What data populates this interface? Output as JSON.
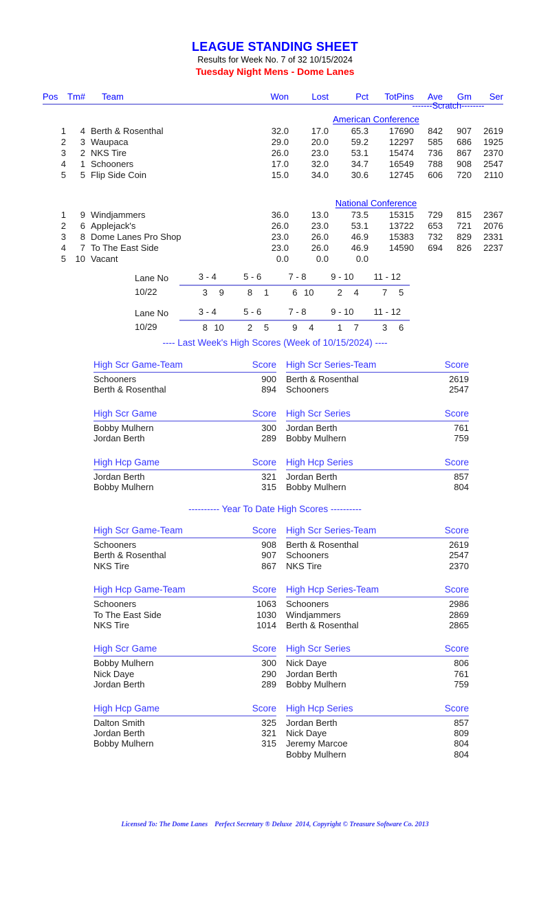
{
  "header": {
    "title": "LEAGUE STANDING SHEET",
    "results_line": "Results for Week No. 7 of 32    10/15/2024",
    "league_line": "Tuesday Night Mens - Dome Lanes",
    "title_color": "#0000ff",
    "league_color": "#ff0000"
  },
  "standings": {
    "scratch_label": "-------Scratch--------",
    "columns": {
      "pos": "Pos",
      "tm": "Tm#",
      "team": "Team",
      "won": "Won",
      "lost": "Lost",
      "pct": "Pct",
      "totpins": "TotPins",
      "ave": "Ave",
      "gm": "Gm",
      "ser": "Ser"
    },
    "conferences": [
      {
        "name": "American Conference",
        "rows": [
          {
            "pos": "1",
            "tm": "4",
            "team": "Berth & Rosenthal",
            "won": "32.0",
            "lost": "17.0",
            "pct": "65.3",
            "totpins": "17690",
            "ave": "842",
            "gm": "907",
            "ser": "2619"
          },
          {
            "pos": "2",
            "tm": "3",
            "team": "Waupaca",
            "won": "29.0",
            "lost": "20.0",
            "pct": "59.2",
            "totpins": "12297",
            "ave": "585",
            "gm": "686",
            "ser": "1925"
          },
          {
            "pos": "3",
            "tm": "2",
            "team": "NKS Tire",
            "won": "26.0",
            "lost": "23.0",
            "pct": "53.1",
            "totpins": "15474",
            "ave": "736",
            "gm": "867",
            "ser": "2370"
          },
          {
            "pos": "4",
            "tm": "1",
            "team": "Schooners",
            "won": "17.0",
            "lost": "32.0",
            "pct": "34.7",
            "totpins": "16549",
            "ave": "788",
            "gm": "908",
            "ser": "2547"
          },
          {
            "pos": "5",
            "tm": "5",
            "team": "Flip Side Coin",
            "won": "15.0",
            "lost": "34.0",
            "pct": "30.6",
            "totpins": "12745",
            "ave": "606",
            "gm": "720",
            "ser": "2110"
          }
        ]
      },
      {
        "name": "National Conference",
        "rows": [
          {
            "pos": "1",
            "tm": "9",
            "team": "Windjammers",
            "won": "36.0",
            "lost": "13.0",
            "pct": "73.5",
            "totpins": "15315",
            "ave": "729",
            "gm": "815",
            "ser": "2367"
          },
          {
            "pos": "2",
            "tm": "6",
            "team": "Applejack's",
            "won": "26.0",
            "lost": "23.0",
            "pct": "53.1",
            "totpins": "13722",
            "ave": "653",
            "gm": "721",
            "ser": "2076"
          },
          {
            "pos": "3",
            "tm": "8",
            "team": "Dome Lanes Pro Shop",
            "won": "23.0",
            "lost": "26.0",
            "pct": "46.9",
            "totpins": "15383",
            "ave": "732",
            "gm": "829",
            "ser": "2331"
          },
          {
            "pos": "4",
            "tm": "7",
            "team": "To The East Side",
            "won": "23.0",
            "lost": "26.0",
            "pct": "46.9",
            "totpins": "14590",
            "ave": "694",
            "gm": "826",
            "ser": "2237"
          },
          {
            "pos": "5",
            "tm": "10",
            "team": "Vacant",
            "won": "0.0",
            "lost": "0.0",
            "pct": "0.0",
            "totpins": "",
            "ave": "",
            "gm": "",
            "ser": ""
          }
        ]
      }
    ]
  },
  "lane_schedule": [
    {
      "lane_label": "Lane No",
      "date_label": "10/22",
      "lane_pairs": [
        "3 - 4",
        "5 - 6",
        "7 - 8",
        "9 - 10",
        "11 - 12"
      ],
      "matchups": [
        {
          "left": "3",
          "right": "9"
        },
        {
          "left": "8",
          "right": "1"
        },
        {
          "left": "6",
          "right": "10"
        },
        {
          "left": "2",
          "right": "4"
        },
        {
          "left": "7",
          "right": "5"
        }
      ]
    },
    {
      "lane_label": "Lane No",
      "date_label": "10/29",
      "lane_pairs": [
        "3 - 4",
        "5 - 6",
        "7 - 8",
        "9 - 10",
        "11 - 12"
      ],
      "matchups": [
        {
          "left": "8",
          "right": "10"
        },
        {
          "left": "2",
          "right": "5"
        },
        {
          "left": "9",
          "right": "4"
        },
        {
          "left": "1",
          "right": "7"
        },
        {
          "left": "3",
          "right": "6"
        }
      ]
    }
  ],
  "last_week": {
    "divider": "----  Last Week's High Scores   (Week of 10/15/2024)  ----",
    "score_header": "Score",
    "blocks": [
      {
        "left": {
          "title": "High Scr Game-Team",
          "rows": [
            {
              "name": "Schooners",
              "score": "900"
            },
            {
              "name": "Berth & Rosenthal",
              "score": "894"
            }
          ]
        },
        "right": {
          "title": "High Scr Series-Team",
          "rows": [
            {
              "name": "Berth & Rosenthal",
              "score": "2619"
            },
            {
              "name": "Schooners",
              "score": "2547"
            }
          ]
        }
      },
      {
        "left": {
          "title": "High Scr Game",
          "rows": [
            {
              "name": "Bobby Mulhern",
              "score": "300"
            },
            {
              "name": "Jordan Berth",
              "score": "289"
            }
          ]
        },
        "right": {
          "title": "High Scr Series",
          "rows": [
            {
              "name": "Jordan Berth",
              "score": "761"
            },
            {
              "name": "Bobby Mulhern",
              "score": "759"
            }
          ]
        }
      },
      {
        "left": {
          "title": "High Hcp Game",
          "rows": [
            {
              "name": "Jordan Berth",
              "score": "321"
            },
            {
              "name": "Bobby Mulhern",
              "score": "315"
            }
          ]
        },
        "right": {
          "title": "High Hcp Series",
          "rows": [
            {
              "name": "Jordan Berth",
              "score": "857"
            },
            {
              "name": "Bobby Mulhern",
              "score": "804"
            }
          ]
        }
      }
    ]
  },
  "year_to_date": {
    "divider": "----------  Year To Date High Scores ----------",
    "score_header": "Score",
    "blocks": [
      {
        "left": {
          "title": "High Scr Game-Team",
          "rows": [
            {
              "name": "Schooners",
              "score": "908"
            },
            {
              "name": "Berth & Rosenthal",
              "score": "907"
            },
            {
              "name": "NKS Tire",
              "score": "867"
            }
          ]
        },
        "right": {
          "title": "High Scr Series-Team",
          "rows": [
            {
              "name": "Berth & Rosenthal",
              "score": "2619"
            },
            {
              "name": "Schooners",
              "score": "2547"
            },
            {
              "name": "NKS Tire",
              "score": "2370"
            }
          ]
        }
      },
      {
        "left": {
          "title": "High Hcp Game-Team",
          "rows": [
            {
              "name": "Schooners",
              "score": "1063"
            },
            {
              "name": "To The East Side",
              "score": "1030"
            },
            {
              "name": "NKS Tire",
              "score": "1014"
            }
          ]
        },
        "right": {
          "title": "High Hcp Series-Team",
          "rows": [
            {
              "name": "Schooners",
              "score": "2986"
            },
            {
              "name": "Windjammers",
              "score": "2869"
            },
            {
              "name": "Berth & Rosenthal",
              "score": "2865"
            }
          ]
        }
      },
      {
        "left": {
          "title": "High Scr Game",
          "rows": [
            {
              "name": "Bobby Mulhern",
              "score": "300"
            },
            {
              "name": "Nick Daye",
              "score": "290"
            },
            {
              "name": "Jordan Berth",
              "score": "289"
            }
          ]
        },
        "right": {
          "title": "High Scr Series",
          "rows": [
            {
              "name": "Nick Daye",
              "score": "806"
            },
            {
              "name": "Jordan Berth",
              "score": "761"
            },
            {
              "name": "Bobby Mulhern",
              "score": "759"
            }
          ]
        }
      },
      {
        "left": {
          "title": "High Hcp Game",
          "rows": [
            {
              "name": "Dalton Smith",
              "score": "325"
            },
            {
              "name": "Jordan Berth",
              "score": "321"
            },
            {
              "name": "Bobby Mulhern",
              "score": "315"
            }
          ]
        },
        "right": {
          "title": "High Hcp Series",
          "rows": [
            {
              "name": "Jordan Berth",
              "score": "857"
            },
            {
              "name": "Nick Daye",
              "score": "809"
            },
            {
              "name": "Jeremy Marcoe",
              "score": "804"
            },
            {
              "name": "Bobby Mulhern",
              "score": "804"
            }
          ]
        }
      }
    ]
  },
  "footer": {
    "text": "Licensed To: The Dome Lanes    Perfect Secretary ® Deluxe  2014, Copyright © Treasure Software Co. 2013"
  }
}
